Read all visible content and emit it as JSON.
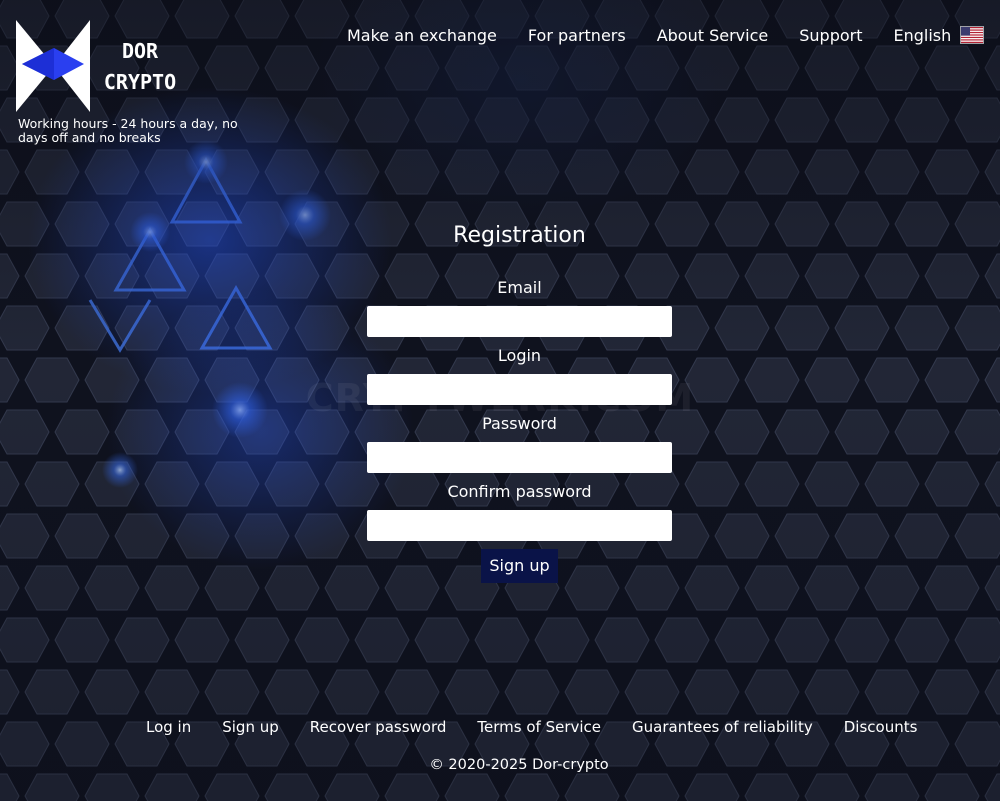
{
  "brand": {
    "name_line1": "DOR",
    "name_line2": "CRYPTO",
    "working_hours": "Working hours - 24 hours a day, no days off and no breaks"
  },
  "nav": {
    "items": [
      "Make an exchange",
      "For partners",
      "About Service",
      "Support"
    ],
    "language": "English",
    "language_flag": "us-flag-icon"
  },
  "form": {
    "title": "Registration",
    "email_label": "Email",
    "email_value": "",
    "login_label": "Login",
    "login_value": "",
    "password_label": "Password",
    "password_value": "",
    "confirm_label": "Confirm password",
    "confirm_value": "",
    "submit_label": "Sign up"
  },
  "watermark": "CRYPTWERK.COM",
  "footer": {
    "links": [
      "Log in",
      "Sign up",
      "Recover password",
      "Terms of Service",
      "Guarantees of reliability",
      "Discounts"
    ],
    "copyright": "© 2020-2025 Dor-crypto"
  },
  "colors": {
    "background": "#1b1f2d",
    "hex_fill": "#262b3c",
    "hex_edge": "#101320",
    "glow": "#2e6bff",
    "button": "#0a1348",
    "logo_blue": "#2a3ff0"
  }
}
